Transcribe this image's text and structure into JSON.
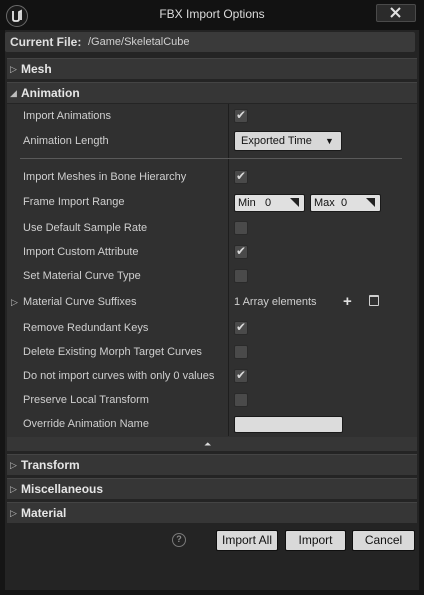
{
  "window": {
    "title": "FBX Import Options",
    "logo": "ue-logo",
    "close_icon": "close-icon"
  },
  "current_file": {
    "label": "Current File:",
    "value": "/Game/SkeletalCube"
  },
  "categories": {
    "mesh": "Mesh",
    "animation": "Animation",
    "transform": "Transform",
    "misc": "Miscellaneous",
    "material": "Material"
  },
  "animation": {
    "import_animations": {
      "label": "Import Animations",
      "checked": true
    },
    "animation_length": {
      "label": "Animation Length",
      "value": "Exported Time"
    },
    "import_meshes_bone_hierarchy": {
      "label": "Import Meshes in Bone Hierarchy",
      "checked": true
    },
    "frame_import_range": {
      "label": "Frame Import Range",
      "min_label": "Min",
      "min_value": "0",
      "max_label": "Max",
      "max_value": "0"
    },
    "use_default_sample_rate": {
      "label": "Use Default Sample Rate",
      "checked": false
    },
    "import_custom_attribute": {
      "label": "Import Custom Attribute",
      "checked": true
    },
    "set_material_curve_type": {
      "label": "Set Material Curve Type",
      "checked": false
    },
    "material_curve_suffixes": {
      "label": "Material Curve Suffixes",
      "value": "1 Array elements",
      "add_icon": "plus-icon",
      "remove_icon": "trash-icon"
    },
    "remove_redundant_keys": {
      "label": "Remove Redundant Keys",
      "checked": true
    },
    "delete_existing_morph_target_curves": {
      "label": "Delete Existing Morph Target Curves",
      "checked": false
    },
    "no_zero_curves": {
      "label": "Do not import curves with only 0 values",
      "checked": true
    },
    "preserve_local_transform": {
      "label": "Preserve Local Transform",
      "checked": false
    },
    "override_animation_name": {
      "label": "Override Animation Name",
      "value": ""
    }
  },
  "footer": {
    "help_icon": "help-icon",
    "import_all": "Import All",
    "import": "Import",
    "cancel": "Cancel"
  },
  "colors": {
    "panel": "#303030",
    "category": "#363636",
    "input_bg": "#d9d9d9",
    "window_bg": "#151515"
  }
}
